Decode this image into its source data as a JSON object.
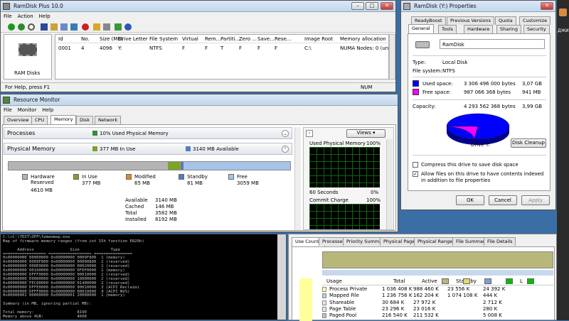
{
  "taskbar": {
    "items": [
      "ДЖИ"
    ]
  },
  "ramdisk": {
    "title": "RamDisk Plus 10.0",
    "menu": [
      "File",
      "Action",
      "Help"
    ],
    "side_label": "RAM Disks",
    "columns": [
      "Id",
      "No.",
      "Size (MB)",
      "Drive Letter",
      "File System",
      "Virtual",
      "Rem...",
      "Partiti...",
      "Zero ...",
      "Save...",
      "Rese...",
      "Image Root",
      "Memory allocation"
    ],
    "row": [
      "0001",
      "4",
      "4096",
      "Y:",
      "NTFS",
      "F",
      "F",
      "T",
      "F",
      "F",
      "F",
      "C:\\",
      "NUMA Nodes: 0 (un)"
    ],
    "status_left": "For Help, press F1",
    "status_right": "NUM"
  },
  "props": {
    "title": "RamDisk (Y:) Properties",
    "tabs_top": [
      "ReadyBoost",
      "Previous Versions",
      "Quota",
      "Customize"
    ],
    "tabs_bottom": [
      "General",
      "Tools",
      "Hardware",
      "Sharing",
      "Security"
    ],
    "name": "RamDisk",
    "type_label": "Type:",
    "type_value": "Local Disk",
    "fs_label": "File system:",
    "fs_value": "NTFS",
    "used_label": "Used space:",
    "used_bytes": "3 306 496 000 bytes",
    "used_size": "3,07 GB",
    "free_label": "Free space:",
    "free_bytes": "987 066 368 bytes",
    "free_size": "941 MB",
    "cap_label": "Capacity:",
    "cap_bytes": "4 293 562 368 bytes",
    "cap_size": "3,99 GB",
    "drive_label": "Drive Y:",
    "cleanup": "Disk Cleanup",
    "compress": "Compress this drive to save disk space",
    "index": "Allow files on this drive to have contents indexed in addition to file properties",
    "ok": "OK",
    "cancel": "Cancel",
    "apply": "Apply",
    "used_fraction": 0.77,
    "used_color": "#0000ff",
    "free_color": "#ff00ff"
  },
  "resmon": {
    "title": "Resource Monitor",
    "menu": [
      "File",
      "Monitor",
      "Help"
    ],
    "tabs": [
      "Overview",
      "CPU",
      "Memory",
      "Disk",
      "Network"
    ],
    "processes_label": "Processes",
    "processes_stat": "10% Used Physical Memory",
    "physical_label": "Physical Memory",
    "inuse_stat": "377 MB In Use",
    "avail_stat": "3140 MB Available",
    "legend": [
      {
        "name": "Hardware Reserved",
        "value": "4610 MB",
        "color": "#b4b4b4"
      },
      {
        "name": "In Use",
        "value": "377 MB",
        "color": "#7ba428"
      },
      {
        "name": "Modified",
        "value": "65 MB",
        "color": "#e38b1c"
      },
      {
        "name": "Standby",
        "value": "81 MB",
        "color": "#4f7fbf"
      },
      {
        "name": "Free",
        "value": "3059 MB",
        "color": "#a7c4e8"
      }
    ],
    "summary": [
      {
        "k": "Available",
        "v": "3140 MB"
      },
      {
        "k": "Cached",
        "v": "146 MB"
      },
      {
        "k": "Total",
        "v": "3582 MB"
      },
      {
        "k": "Installed",
        "v": "8192 MB"
      }
    ],
    "views": "Views",
    "graph1_title": "Used Physical Memory",
    "graph1_max": "100%",
    "graph1_left": "60 Seconds",
    "graph1_right": "0%",
    "graph2_title": "Commit Charge",
    "graph2_max": "100%"
  },
  "console": {
    "lines": [
      "C:\\>C:\\TEST\\OFP\\fwmemmap.exe",
      "Map of firmware memory ranges (from int 15h function E820h)",
      "",
      "      Address               Size             Type",
      "================== ================== ================",
      "0x00000000`00000000 0x00000000`0009F800  1 (memory)",
      "0x00000000`0009F800 0x00000000`00000800  2 (reserved)",
      "0x00000000`000E0000 0x00000000`00020000  2 (reserved)",
      "0x00000000`00100000 0x00000000`DFEF0000  1 (memory)",
      "0x00000000`DFFF0000 0x00000000`00010000  2 (reserved)",
      "0x00000000`E0000000 0x00000000`10000000  2 (reserved)",
      "0x00000000`FEC00000 0x00000000`01400000  2 (reserved)",
      "0x00000000`DFFE0000 0x00000000`00010000  3 (ACPI Reclaim)",
      "0x00000000`DFFF0000 0x00000000`00010000  4 (ACPI NVS)",
      "0x00000001`00000000 0x00000001`20000000  1 (memory)",
      "",
      "Summary (in MB, ignoring partial MB):",
      "",
      "Total memory:                  8190",
      "Memory above 4GB:              4608"
    ]
  },
  "rammap": {
    "tabs": [
      "Use Counts",
      "Processes",
      "Priority Summary",
      "Physical Pages",
      "Physical Ranges",
      "File Summary",
      "File Details"
    ],
    "headers": [
      "Usage",
      "Total",
      "Active",
      "Standby",
      "",
      "",
      "L"
    ],
    "rows": [
      {
        "usage": "Process Private",
        "total": "1 036 408 K",
        "active": "988 460 K",
        "standby": "23 556 K",
        "extra": "24 392 K",
        "color": "#ffff9c"
      },
      {
        "usage": "Mapped File",
        "total": "1 236 756 K",
        "active": "162 204 K",
        "standby": "1 074 108 K",
        "extra": "444 K",
        "color": "#b9cde5"
      },
      {
        "usage": "Shareable",
        "total": "30 684 K",
        "active": "27 972 K",
        "standby": "",
        "extra": "2 712 K",
        "color": "#e6e6e6"
      },
      {
        "usage": "Page Table",
        "total": "23 296 K",
        "active": "23 016 K",
        "standby": "",
        "extra": "280 K",
        "color": "#e6e6e6"
      },
      {
        "usage": "Paged Pool",
        "total": "216 540 K",
        "active": "211 532 K",
        "standby": "",
        "extra": "5 008 K",
        "color": "#c0c0c0"
      }
    ]
  }
}
